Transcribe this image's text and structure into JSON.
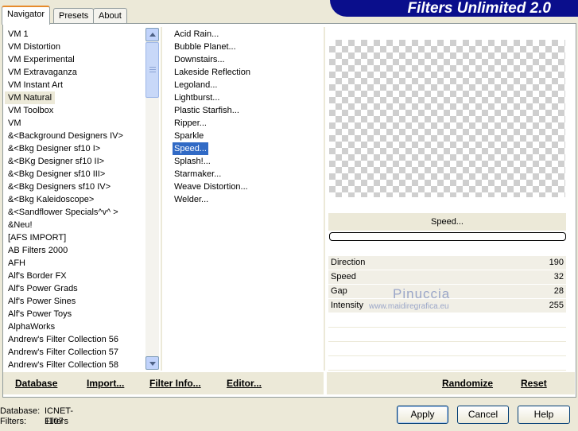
{
  "tabs": [
    "Navigator",
    "Presets",
    "About"
  ],
  "banner_title": "Filters Unlimited 2.0",
  "categories": [
    "VM 1",
    "VM Distortion",
    "VM Experimental",
    "VM Extravaganza",
    "VM Instant Art",
    "VM Natural",
    "VM Toolbox",
    "VM",
    "&<Background Designers IV>",
    "&<Bkg Designer sf10 I>",
    "&<BKg Designer sf10 II>",
    "&<Bkg Designer sf10 III>",
    "&<Bkg Designers sf10 IV>",
    "&<Bkg Kaleidoscope>",
    "&<Sandflower Specials^v^ >",
    "&Neu!",
    "[AFS IMPORT]",
    "AB Filters 2000",
    "AFH",
    "Alf's Border FX",
    "Alf's Power Grads",
    "Alf's Power Sines",
    "Alf's Power Toys",
    "AlphaWorks",
    "Andrew's Filter Collection 56",
    "Andrew's Filter Collection 57",
    "Andrew's Filter Collection 58"
  ],
  "selected_category": "VM Natural",
  "filters": [
    "Acid Rain...",
    "Bubble Planet...",
    "Downstairs...",
    "Lakeside Reflection",
    "Legoland...",
    "Lightburst...",
    "Plastic Starfish...",
    "Ripper...",
    "Sparkle",
    "Speed...",
    "Splash!...",
    "Starmaker...",
    "Weave Distortion...",
    "Welder..."
  ],
  "selected_filter": "Speed...",
  "current_filter": "Speed...",
  "params": [
    {
      "label": "Direction",
      "value": "190"
    },
    {
      "label": "Speed",
      "value": "32"
    },
    {
      "label": "Gap",
      "value": "28"
    },
    {
      "label": "Intensity",
      "value": "255"
    }
  ],
  "watermark": {
    "name": "Pinuccia",
    "url": "www.maidiregrafica.eu"
  },
  "links": {
    "database": "Database",
    "import": "Import...",
    "filter_info": "Filter Info...",
    "editor": "Editor...",
    "randomize": "Randomize",
    "reset": "Reset"
  },
  "status": {
    "database_label": "Database:",
    "database_value": "ICNET-Filters",
    "filters_label": "Filters:",
    "filters_value": "1107"
  },
  "buttons": {
    "apply": "Apply",
    "cancel": "Cancel",
    "help": "Help"
  },
  "colors": {
    "banner": "#0a0e8c",
    "selection": "#316ac5",
    "tab_highlight": "#e68b2c"
  }
}
